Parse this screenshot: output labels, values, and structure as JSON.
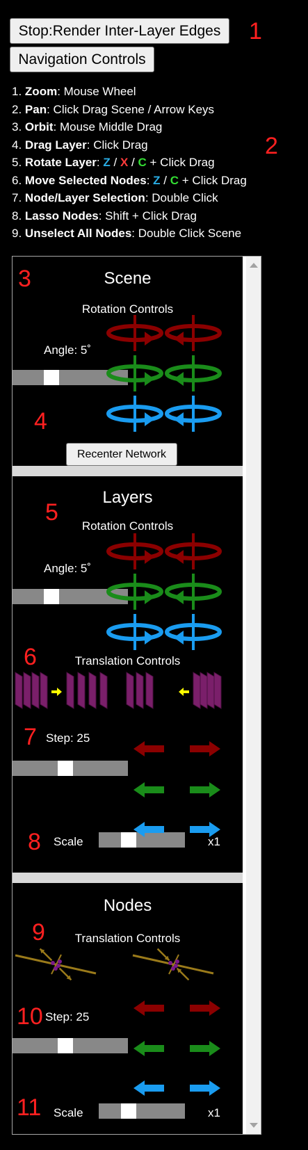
{
  "toolbar": {
    "toggle_edges_label": "Stop:Render Inter-Layer Edges",
    "nav_controls_label": "Navigation Controls"
  },
  "markers": [
    "1",
    "2",
    "3",
    "4",
    "5",
    "6",
    "7",
    "8",
    "9",
    "10",
    "11"
  ],
  "nav_help": [
    {
      "num": "1.",
      "action": "Zoom",
      "desc": ": Mouse Wheel"
    },
    {
      "num": "2.",
      "action": "Pan",
      "desc": ": Click Drag Scene / Arrow Keys"
    },
    {
      "num": "3.",
      "action": "Orbit",
      "desc": ": Mouse Middle Drag"
    },
    {
      "num": "4.",
      "action": "Drag Layer",
      "desc": ": Click Drag"
    },
    {
      "num": "5.",
      "action": "Rotate Layer",
      "desc": ":"
    },
    {
      "num": "6.",
      "action": "Move Selected Nodes",
      "desc": ":"
    },
    {
      "num": "7.",
      "action": "Node/Layer Selection",
      "desc": ": Double Click"
    },
    {
      "num": "8.",
      "action": "Lasso Nodes",
      "desc": ": Shift + Click Drag"
    },
    {
      "num": "9.",
      "action": "Unselect All Nodes",
      "desc": ": Double Click Scene"
    }
  ],
  "keys": {
    "z": "Z",
    "x": "X",
    "c": "C",
    "slash": "/",
    "plus_drag": "+ Click Drag"
  },
  "scene": {
    "title": "Scene",
    "rotation_title": "Rotation Controls",
    "angle_label": "Angle: 5˚",
    "angle_value_fraction": 0.31,
    "recenter_label": "Recenter Network"
  },
  "layers": {
    "title": "Layers",
    "rotation_title": "Rotation Controls",
    "angle_label": "Angle: 5˚",
    "angle_value_fraction": 0.31,
    "translation_title": "Translation Controls",
    "step_label": "Step: 25",
    "step_value_fraction": 0.45,
    "scale_label": "Scale",
    "scale_value": "x1",
    "scale_value_fraction": 0.31
  },
  "nodes": {
    "title": "Nodes",
    "translation_title": "Translation Controls",
    "step_label": "Step: 25",
    "step_value_fraction": 0.45,
    "scale_label": "Scale",
    "scale_value": "x1",
    "scale_value_fraction": 0.31
  },
  "colors": {
    "axis_x": "#8b0000",
    "axis_y": "#1a8c1a",
    "axis_z": "#1a9cf0",
    "layer_plane": "#7a1f6a",
    "yellow_arrow": "#ffff00",
    "node_edge": "#9a7a1a",
    "node": "#7a1a8a"
  }
}
